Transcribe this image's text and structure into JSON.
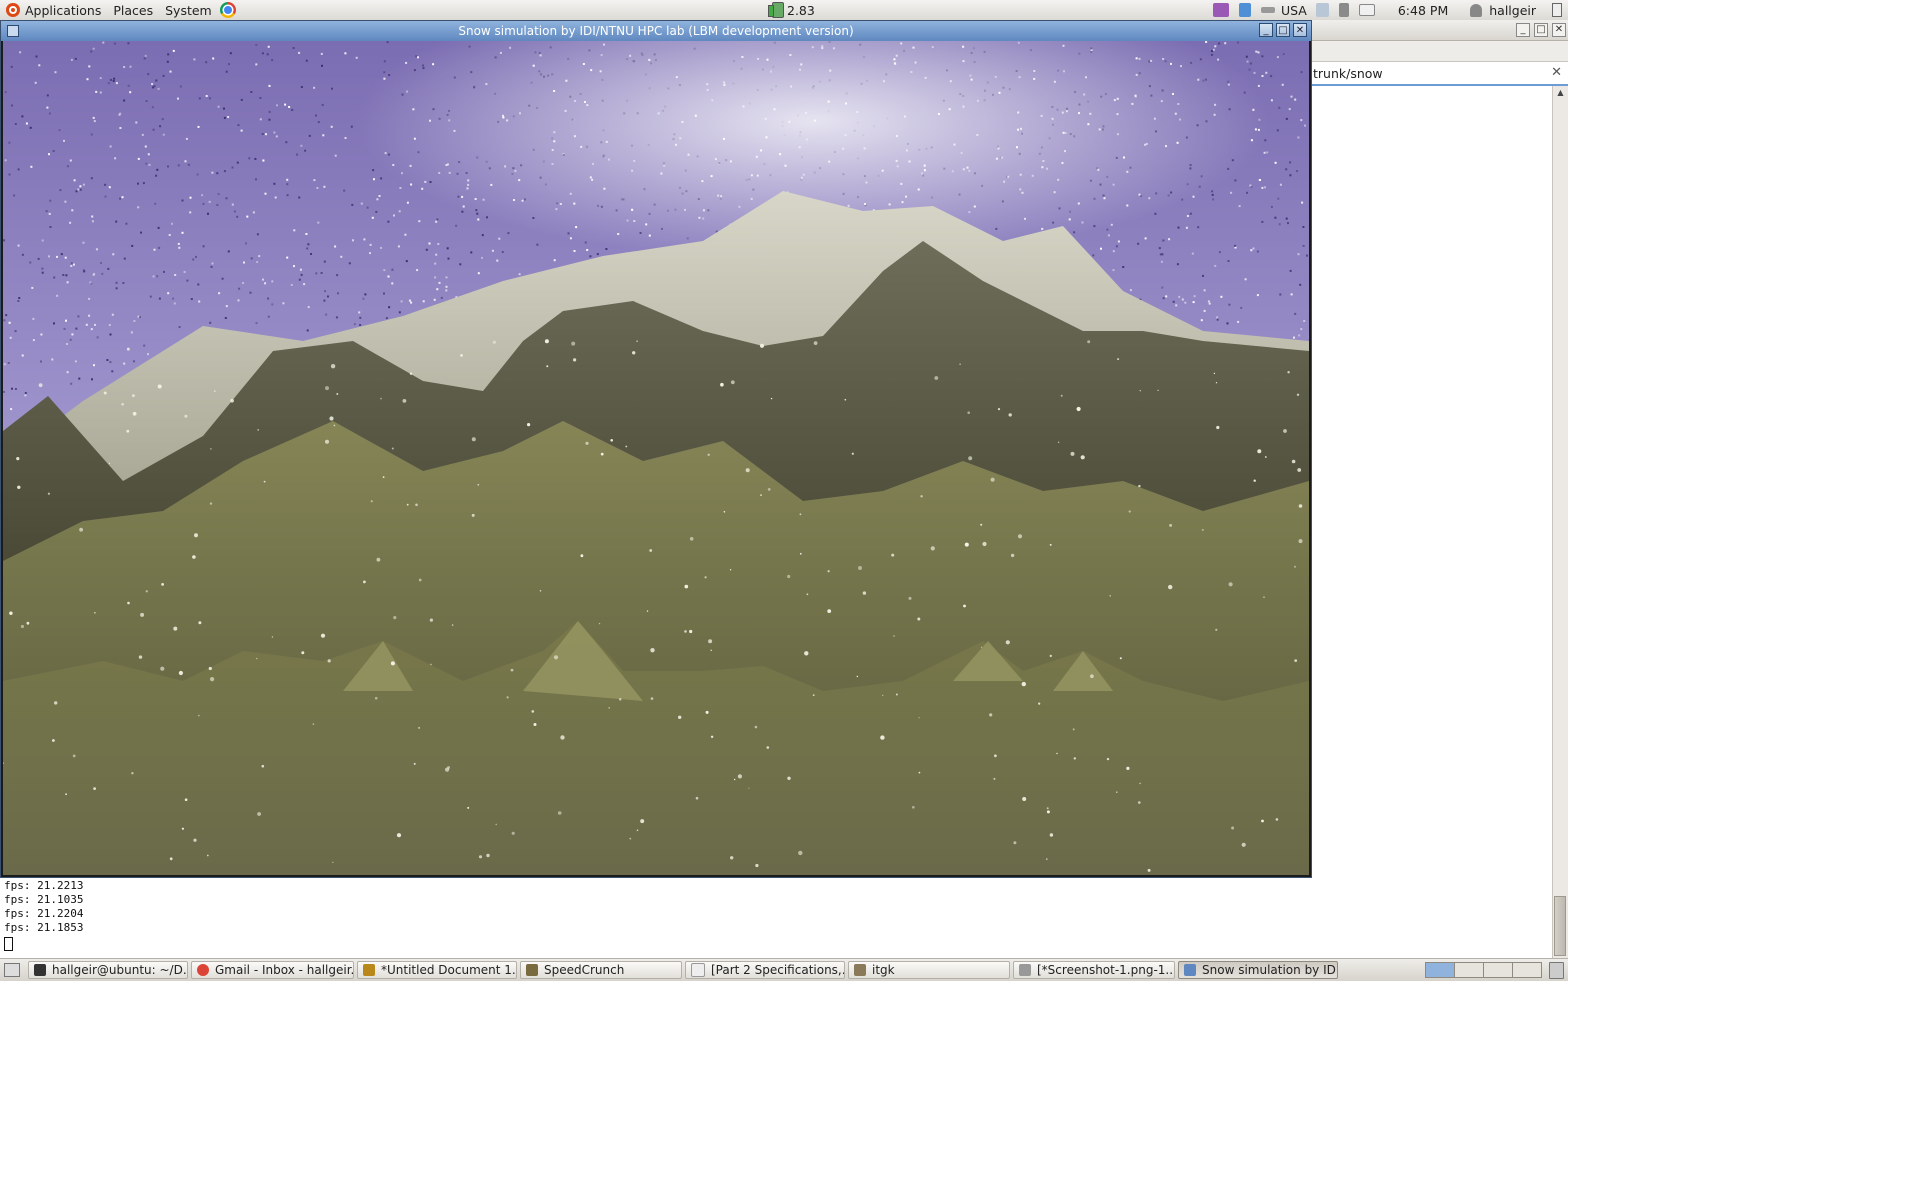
{
  "top_panel": {
    "menus": [
      "Applications",
      "Places",
      "System"
    ],
    "battery_value": "2.83",
    "keyboard_layout": "USA",
    "clock": "6:48 PM",
    "username": "hallgeir",
    "icons": [
      "ubuntu-logo-icon",
      "chrome-icon",
      "battery-icon",
      "dropbox-icon",
      "network-icon",
      "search-icon",
      "volume-icon",
      "mail-icon",
      "user-icon",
      "power-icon"
    ]
  },
  "sim_window": {
    "title": "Snow simulation by IDI/NTNU HPC lab (LBM development version)",
    "controls": [
      "_",
      "□",
      "✕"
    ]
  },
  "bg_window": {
    "tab_label": "trunk/snow",
    "controls": [
      "_",
      "□",
      "✕"
    ],
    "tab_close": "✕"
  },
  "terminal": {
    "lines": [
      "fps: 21.2213",
      "fps: 21.1035",
      "fps: 21.2204",
      "fps: 21.1853"
    ]
  },
  "taskbar": {
    "tasks": [
      {
        "label": "hallgeir@ubuntu: ~/D...",
        "icon": "terminal-icon",
        "color": "#333333"
      },
      {
        "label": "Gmail - Inbox - hallgeir...",
        "icon": "chrome-icon",
        "color": "#db4437"
      },
      {
        "label": "*Untitled Document 1...",
        "icon": "text-editor-icon",
        "color": "#b9881a"
      },
      {
        "label": "SpeedCrunch",
        "icon": "calculator-icon",
        "color": "#7a6a40"
      },
      {
        "label": "[Part 2 Specifications,...",
        "icon": "document-icon",
        "color": "#dddddd"
      },
      {
        "label": "itgk",
        "icon": "folder-icon",
        "color": "#8a7a5a"
      },
      {
        "label": "[*Screenshot-1.png-1....",
        "icon": "image-icon",
        "color": "#999999"
      },
      {
        "label": "Snow simulation by ID...",
        "icon": "window-icon",
        "color": "#5f88c0",
        "active": true
      }
    ]
  },
  "colors": {
    "sky": "#5a4a8c",
    "titlebar": "#6f97cc",
    "terrain": "#6b6a3e"
  }
}
